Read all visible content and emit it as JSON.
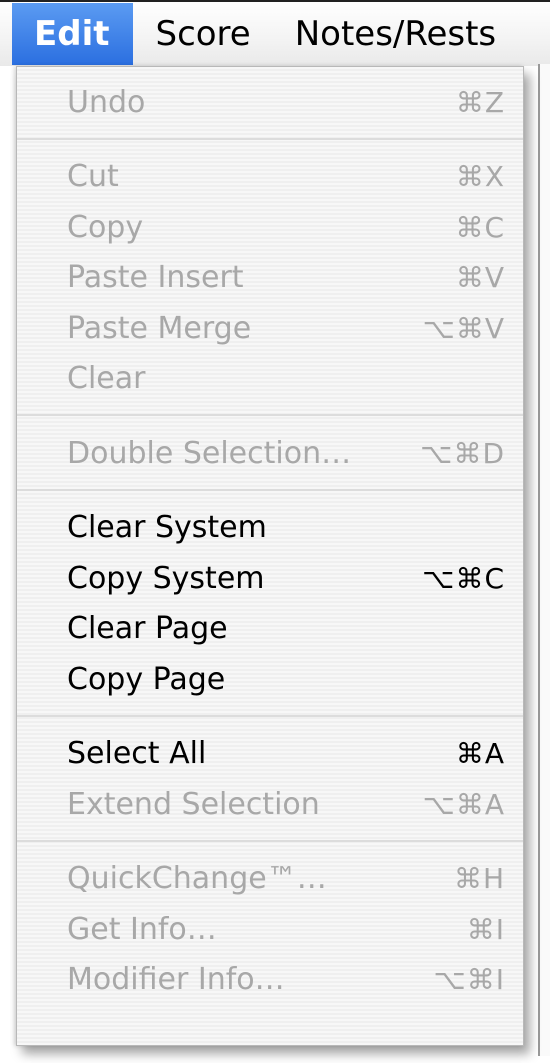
{
  "menubar": {
    "items": [
      {
        "label": "Edit"
      },
      {
        "label": "Score"
      },
      {
        "label": "Notes/Rests"
      }
    ]
  },
  "menu": {
    "groups": [
      [
        {
          "label": "Undo",
          "shortcut": "⌘Z",
          "enabled": false
        }
      ],
      [
        {
          "label": "Cut",
          "shortcut": "⌘X",
          "enabled": false
        },
        {
          "label": "Copy",
          "shortcut": "⌘C",
          "enabled": false
        },
        {
          "label": "Paste Insert",
          "shortcut": "⌘V",
          "enabled": false
        },
        {
          "label": "Paste Merge",
          "shortcut": "⌥⌘V",
          "enabled": false
        },
        {
          "label": "Clear",
          "shortcut": "",
          "enabled": false
        }
      ],
      [
        {
          "label": "Double Selection…",
          "shortcut": "⌥⌘D",
          "enabled": false
        }
      ],
      [
        {
          "label": "Clear System",
          "shortcut": "",
          "enabled": true
        },
        {
          "label": "Copy System",
          "shortcut": "⌥⌘C",
          "enabled": true
        },
        {
          "label": "Clear Page",
          "shortcut": "",
          "enabled": true
        },
        {
          "label": "Copy Page",
          "shortcut": "",
          "enabled": true
        }
      ],
      [
        {
          "label": "Select All",
          "shortcut": "⌘A",
          "enabled": true
        },
        {
          "label": "Extend Selection",
          "shortcut": "⌥⌘A",
          "enabled": false
        }
      ],
      [
        {
          "label": "QuickChange™…",
          "shortcut": "⌘H",
          "enabled": false
        },
        {
          "label": "Get Info…",
          "shortcut": "⌘I",
          "enabled": false
        },
        {
          "label": "Modifier Info…",
          "shortcut": "⌥⌘I",
          "enabled": false
        }
      ]
    ]
  },
  "colors": {
    "active_menu_bg": "#3a7ce8",
    "disabled_text": "#a8a8a8",
    "enabled_text": "#000000"
  }
}
